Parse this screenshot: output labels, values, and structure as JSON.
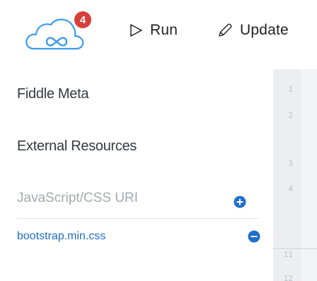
{
  "header": {
    "notification_count": "4",
    "run_label": "Run",
    "update_label": "Update",
    "logo_icon": "cloud-infinity-icon",
    "run_icon": "play-icon",
    "update_icon": "pencil-icon"
  },
  "sidebar": {
    "fiddle_meta_title": "Fiddle Meta",
    "external_resources_title": "External Resources",
    "uri_placeholder": "JavaScript/CSS URI",
    "add_icon": "plus-circle-icon",
    "resources": [
      {
        "name": "bootstrap.min.css",
        "remove_icon": "minus-circle-icon"
      }
    ]
  },
  "editor": {
    "line_numbers": [
      "1",
      "2",
      "3",
      "4",
      "11",
      "12"
    ]
  },
  "colors": {
    "accent": "#1f6fc9",
    "badge": "#d8403a",
    "logo": "#3d9be9",
    "text": "#333a42",
    "placeholder": "#a4a9af",
    "gutter": "#eceef1"
  }
}
